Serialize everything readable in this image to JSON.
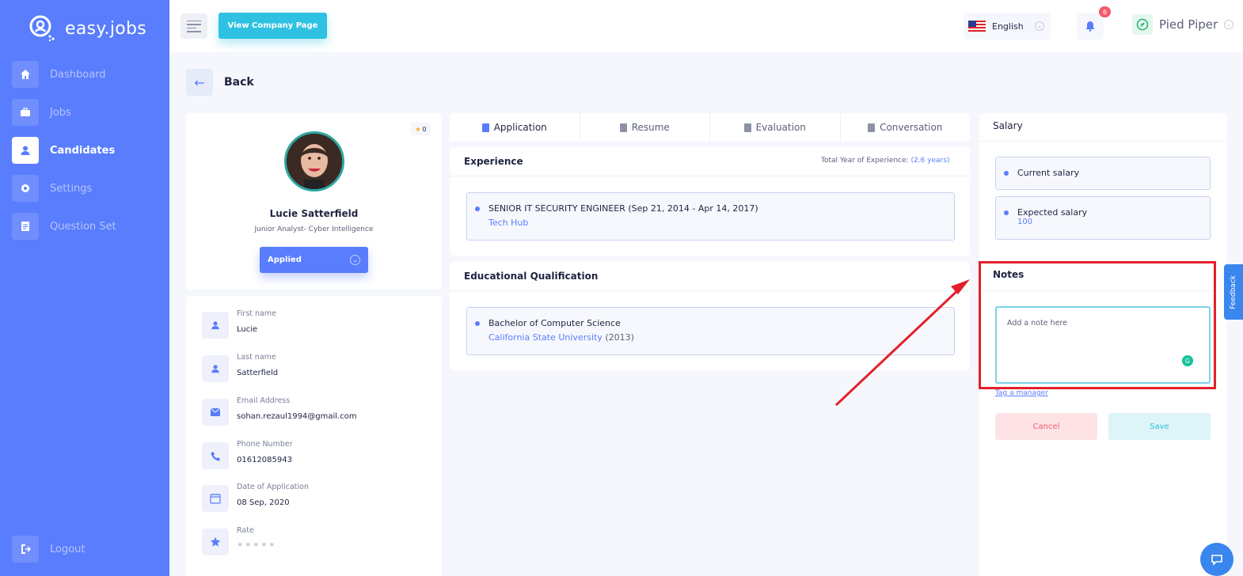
{
  "brand": {
    "name": "easy.jobs"
  },
  "sidebar": {
    "items": [
      {
        "label": "Dashboard"
      },
      {
        "label": "Jobs"
      },
      {
        "label": "Candidates"
      },
      {
        "label": "Settings"
      },
      {
        "label": "Question Set"
      }
    ],
    "logout": "Logout"
  },
  "topbar": {
    "view_company_label": "View Company Page",
    "language": "English",
    "notifications_count": "6",
    "company_name": "Pied Piper"
  },
  "page": {
    "back_label": "Back"
  },
  "candidate": {
    "rating_badge": "0",
    "name": "Lucie Satterfield",
    "title": "Junior Analyst- Cyber Intelligence",
    "status": "Applied",
    "fields": [
      {
        "label": "First name",
        "value": "Lucie"
      },
      {
        "label": "Last name",
        "value": "Satterfield"
      },
      {
        "label": "Email Address",
        "value": "sohan.rezaul1994@gmail.com"
      },
      {
        "label": "Phone Number",
        "value": "01612085943"
      },
      {
        "label": "Date of Application",
        "value": "08 Sep, 2020"
      },
      {
        "label": "Rate",
        "value": "★★★★★"
      }
    ]
  },
  "tabs": [
    {
      "label": "Application"
    },
    {
      "label": "Resume"
    },
    {
      "label": "Evaluation"
    },
    {
      "label": "Conversation"
    }
  ],
  "experience": {
    "title": "Experience",
    "total_label": "Total Year of Experience:",
    "total_value": "(2.6 years)",
    "items": [
      {
        "position": "SENIOR IT SECURITY ENGINEER (Sep 21, 2014 - Apr 14, 2017)",
        "company": "Tech Hub"
      }
    ]
  },
  "education": {
    "title": "Educational Qualification",
    "items": [
      {
        "degree": "Bachelor of Computer Science",
        "institution": "California State University",
        "year": "(2013)"
      }
    ]
  },
  "salary": {
    "title": "Salary",
    "current_label": "Current salary",
    "current_value": "",
    "expected_label": "Expected salary",
    "expected_value": "100"
  },
  "notes": {
    "title": "Notes",
    "placeholder": "Add a note here",
    "tag_manager": "Tag a manager",
    "cancel_label": "Cancel",
    "save_label": "Save"
  },
  "feedback_label": "Feedback",
  "colors": {
    "primary": "#597dfc",
    "accent": "#2fc1e1",
    "highlight": "#e3202a"
  }
}
